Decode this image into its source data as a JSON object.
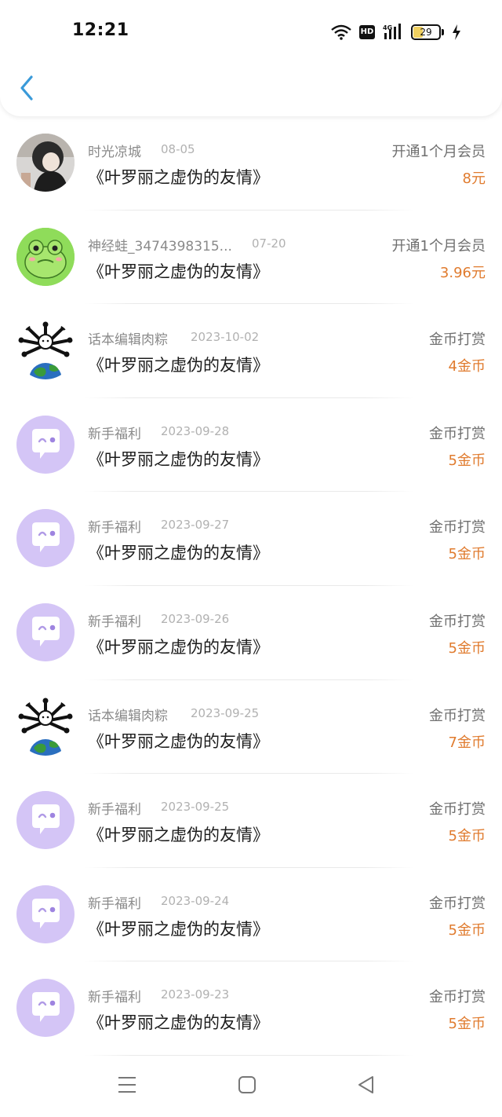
{
  "status_bar": {
    "time": "12:21",
    "battery": "29",
    "icons": [
      "wifi-icon",
      "hd-icon",
      "signal-4g-icon",
      "battery-icon",
      "charging-icon"
    ],
    "hd_label": "HD",
    "network_label": "4G"
  },
  "nav": {
    "back_icon": "chevron-left-icon",
    "accent_color": "#3a9ad9"
  },
  "colors": {
    "amount": "#e07b2e",
    "bot_avatar": "#d4c5f6"
  },
  "records": [
    {
      "avatar": "photo",
      "name": "时光凉城",
      "date": "08-05",
      "book": "《叶罗丽之虚伪的友情》",
      "type": "开通1个月会员",
      "amount": "8元"
    },
    {
      "avatar": "frog",
      "name": "神经蛙_3474398315...",
      "date": "07-20",
      "book": "《叶罗丽之虚伪的友情》",
      "type": "开通1个月会员",
      "amount": "3.96元"
    },
    {
      "avatar": "globe",
      "name": "话本编辑肉粽",
      "date": "2023-10-02",
      "book": "《叶罗丽之虚伪的友情》",
      "type": "金币打赏",
      "amount": "4金币"
    },
    {
      "avatar": "bot",
      "name": "新手福利",
      "date": "2023-09-28",
      "book": "《叶罗丽之虚伪的友情》",
      "type": "金币打赏",
      "amount": "5金币"
    },
    {
      "avatar": "bot",
      "name": "新手福利",
      "date": "2023-09-27",
      "book": "《叶罗丽之虚伪的友情》",
      "type": "金币打赏",
      "amount": "5金币"
    },
    {
      "avatar": "bot",
      "name": "新手福利",
      "date": "2023-09-26",
      "book": "《叶罗丽之虚伪的友情》",
      "type": "金币打赏",
      "amount": "5金币"
    },
    {
      "avatar": "globe",
      "name": "话本编辑肉粽",
      "date": "2023-09-25",
      "book": "《叶罗丽之虚伪的友情》",
      "type": "金币打赏",
      "amount": "7金币"
    },
    {
      "avatar": "bot",
      "name": "新手福利",
      "date": "2023-09-25",
      "book": "《叶罗丽之虚伪的友情》",
      "type": "金币打赏",
      "amount": "5金币"
    },
    {
      "avatar": "bot",
      "name": "新手福利",
      "date": "2023-09-24",
      "book": "《叶罗丽之虚伪的友情》",
      "type": "金币打赏",
      "amount": "5金币"
    },
    {
      "avatar": "bot",
      "name": "新手福利",
      "date": "2023-09-23",
      "book": "《叶罗丽之虚伪的友情》",
      "type": "金币打赏",
      "amount": "5金币"
    }
  ],
  "system_nav": {
    "icons": [
      "menu-icon",
      "home-square-icon",
      "back-triangle-icon"
    ]
  }
}
